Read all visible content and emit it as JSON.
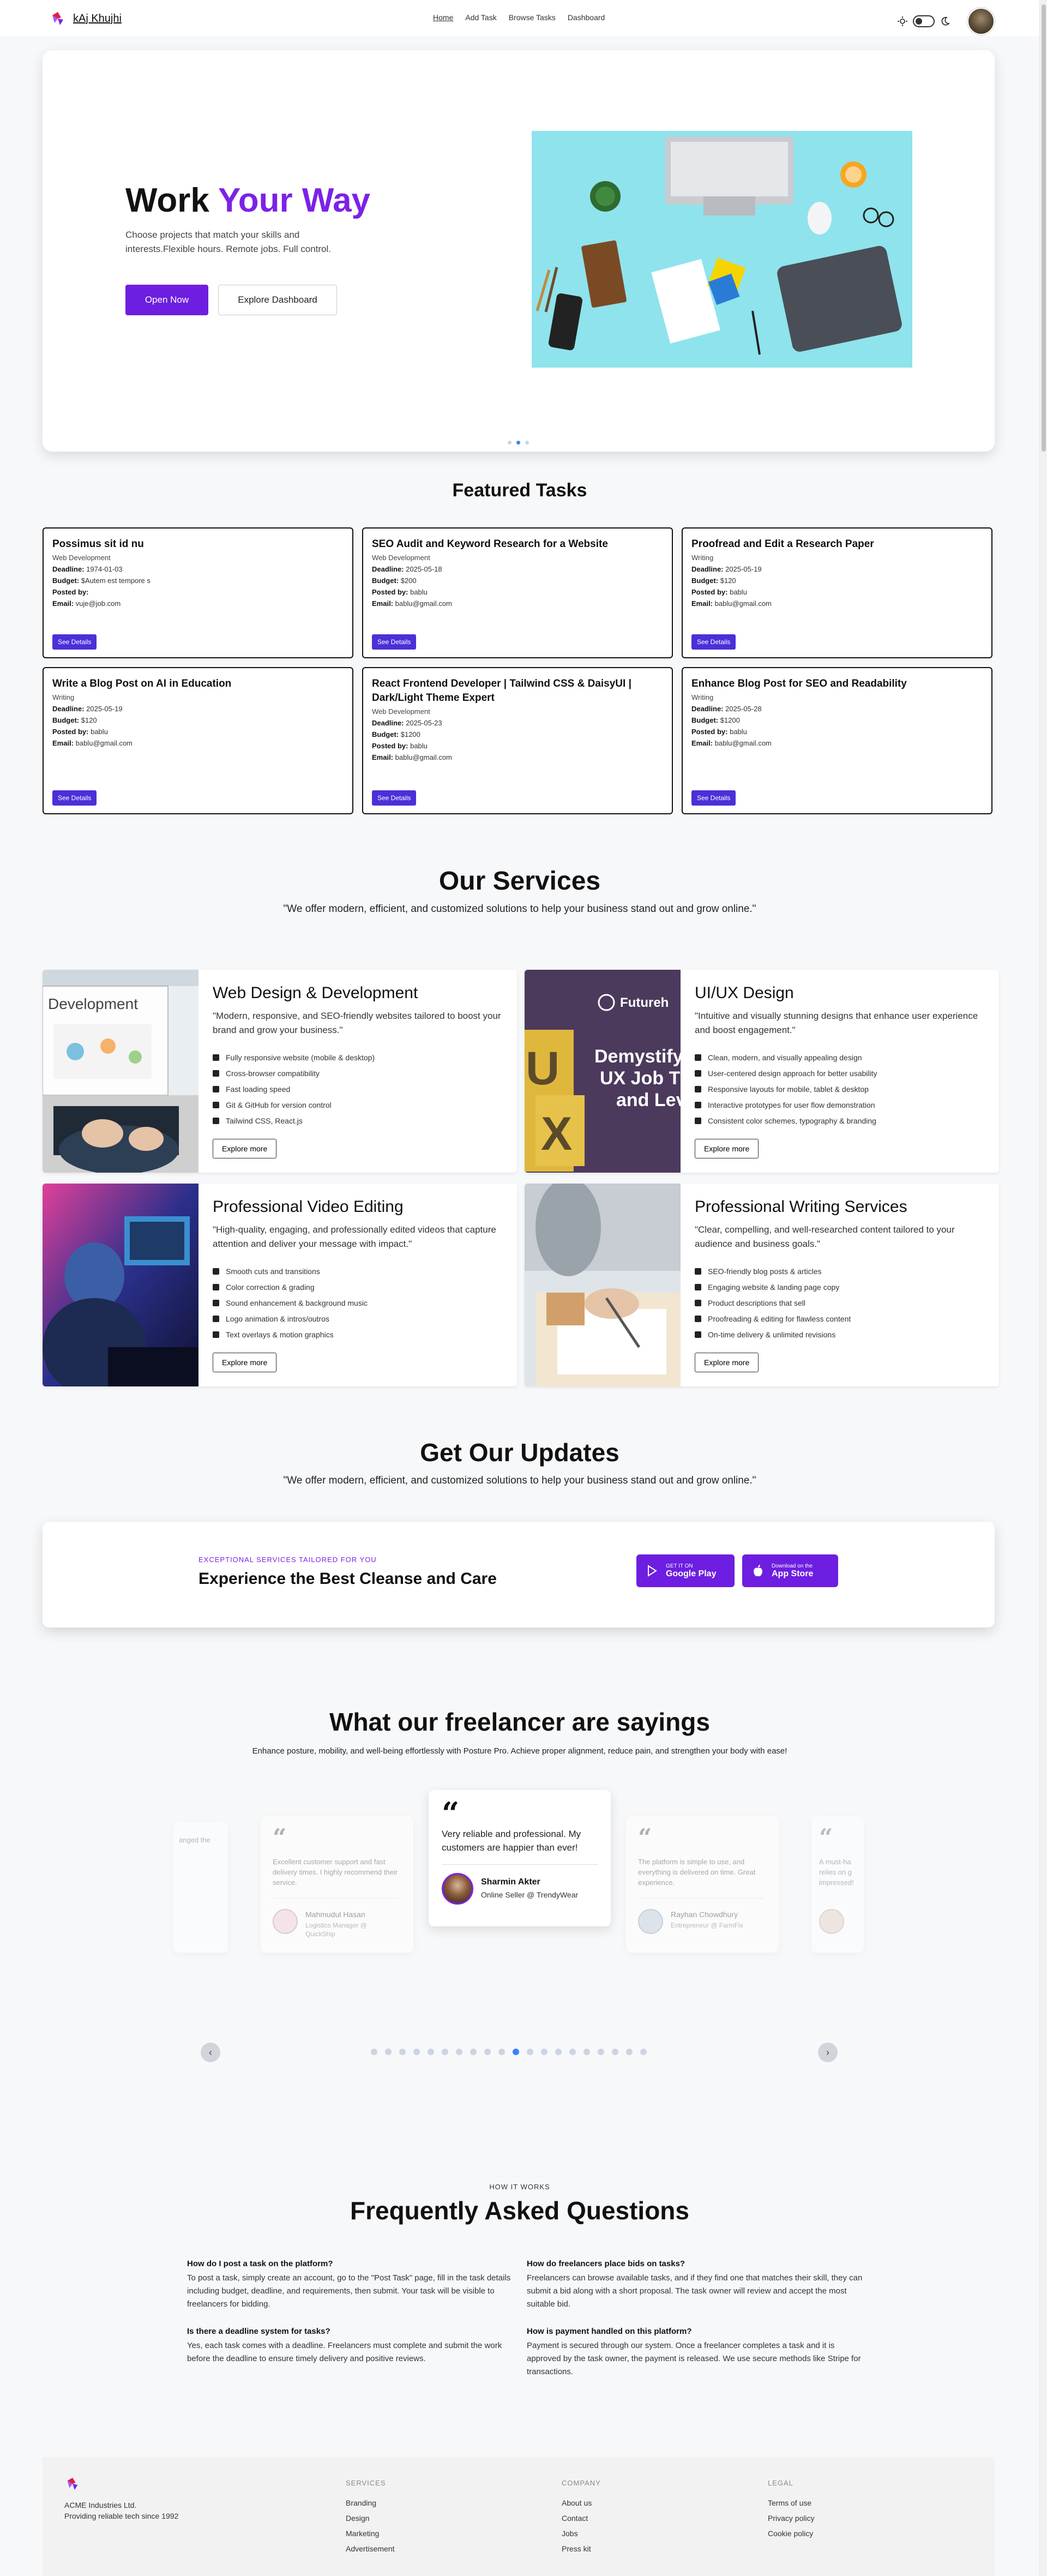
{
  "nav": {
    "brand": "kAj Khujhi",
    "links": [
      "Home",
      "Add Task",
      "Browse Tasks",
      "Dashboard"
    ]
  },
  "hero": {
    "title_part1": "Work",
    "title_part2": "Your Way",
    "subtitle": "Choose projects that match your skills and interests.Flexible hours. Remote jobs. Full control.",
    "primary_button": "Open Now",
    "secondary_button": "Explore Dashboard"
  },
  "featured": {
    "title": "Featured Tasks",
    "button_label": "See Details",
    "labels": {
      "deadline": "Deadline:",
      "budget": "Budget:",
      "posted_by": "Posted by:",
      "email": "Email:"
    },
    "tasks": [
      {
        "title": "Possimus sit id nu",
        "category": "Web Development",
        "deadline": "1974-01-03",
        "budget": "$Autem est tempore s",
        "posted_by": "",
        "email": "vuje@job.com"
      },
      {
        "title": "SEO Audit and Keyword Research for a Website",
        "category": "Web Development",
        "deadline": "2025-05-18",
        "budget": "$200",
        "posted_by": "bablu",
        "email": "bablu@gmail.com"
      },
      {
        "title": "Proofread and Edit a Research Paper",
        "category": "Writing",
        "deadline": "2025-05-19",
        "budget": "$120",
        "posted_by": "bablu",
        "email": "bablu@gmail.com"
      },
      {
        "title": "Write a Blog Post on AI in Education",
        "category": "Writing",
        "deadline": "2025-05-19",
        "budget": "$120",
        "posted_by": "bablu",
        "email": "bablu@gmail.com"
      },
      {
        "title": "React Frontend Developer | Tailwind CSS & DaisyUI | Dark/Light Theme Expert",
        "category": "Web Development",
        "deadline": "2025-05-23",
        "budget": "$1200",
        "posted_by": "bablu",
        "email": "bablu@gmail.com"
      },
      {
        "title": "Enhance Blog Post for SEO and Readability",
        "category": "Writing",
        "deadline": "2025-05-28",
        "budget": "$1200",
        "posted_by": "bablu",
        "email": "bablu@gmail.com"
      }
    ]
  },
  "services": {
    "title": "Our Services",
    "subtitle": "\"We offer modern, efficient, and customized solutions to help your business stand out and grow online.\"",
    "explore_label": "Explore more",
    "items": [
      {
        "title": "Web Design & Development",
        "desc": "\"Modern, responsive, and SEO-friendly websites tailored to boost your brand and grow your business.\"",
        "image_text": "Development",
        "features": [
          "Fully responsive website (mobile & desktop)",
          "Cross-browser compatibility",
          "Fast loading speed",
          "Git & GitHub for version control",
          "Tailwind CSS, React.js"
        ]
      },
      {
        "title": "UI/UX Design",
        "desc": "\"Intuitive and visually stunning designs that enhance user experience and boost engagement.\"",
        "image_text_brand": "Futureh",
        "image_text_lines": [
          "Demystify",
          "UX Job T",
          "and Lev"
        ],
        "features": [
          "Clean, modern, and visually appealing design",
          "User-centered design approach for better usability",
          "Responsive layouts for mobile, tablet & desktop",
          "Interactive prototypes for user flow demonstration",
          "Consistent color schemes, typography & branding"
        ]
      },
      {
        "title": "Professional Video Editing",
        "desc": "\"High-quality, engaging, and professionally edited videos that capture attention and deliver your message with impact.\"",
        "features": [
          "Smooth cuts and transitions",
          "Color correction & grading",
          "Sound enhancement & background music",
          "Logo animation & intros/outros",
          "Text overlays & motion graphics"
        ]
      },
      {
        "title": "Professional Writing Services",
        "desc": "\"Clear, compelling, and well-researched content tailored to your audience and business goals.\"",
        "features": [
          "SEO-friendly blog posts & articles",
          "Engaging website & landing page copy",
          "Product descriptions that sell",
          "Proofreading & editing for flawless content",
          "On-time delivery & unlimited revisions"
        ]
      }
    ]
  },
  "updates": {
    "title": "Get Our Updates",
    "subtitle": "\"We offer modern, efficient, and customized solutions to help your business stand out and grow online.\"",
    "tag": "EXCEPTIONAL SERVICES TAILORED FOR YOU",
    "heading": "Experience the Best Cleanse and Care",
    "google_small": "GET IT ON",
    "google_big": "Google Play",
    "apple_small": "Download on the",
    "apple_big": "App Store"
  },
  "testimonials": {
    "title": "What our freelancer are sayings",
    "subtitle": "Enhance posture, mobility, and well-being effortlessly with Posture Pro. Achieve proper alignment, reduce pain, and strengthen your body with ease!",
    "edge_left_text": "anged the",
    "edge_right_text": "A must-ha\nrelies on g\nimpressed!",
    "center": {
      "quote": "Very reliable and professional. My customers are happier than ever!",
      "name": "Sharmin Akter",
      "role": "Online Seller @ TrendyWear"
    },
    "left": {
      "quote": "Excellent customer support and fast delivery times. I highly recommend their service.",
      "name": "Mahmudul Hasan",
      "role": "Logistics Manager @ QuickShip"
    },
    "right": {
      "quote": "The platform is simple to use, and everything is delivered on time. Great experience.",
      "name": "Rayhan Chowdhury",
      "role": "Entrepreneur @ FarmFix"
    },
    "active_dot": 10,
    "dot_count": 20
  },
  "faq": {
    "eyebrow": "HOW IT WORKS",
    "title": "Frequently Asked Questions",
    "items": [
      {
        "q": "How do I post a task on the platform?",
        "a": "To post a task, simply create an account, go to the \"Post Task\" page, fill in the task details including budget, deadline, and requirements, then submit. Your task will be visible to freelancers for bidding."
      },
      {
        "q": "How do freelancers place bids on tasks?",
        "a": "Freelancers can browse available tasks, and if they find one that matches their skill, they can submit a bid along with a short proposal. The task owner will review and accept the most suitable bid."
      },
      {
        "q": "Is there a deadline system for tasks?",
        "a": "Yes, each task comes with a deadline. Freelancers must complete and submit the work before the deadline to ensure timely delivery and positive reviews."
      },
      {
        "q": "How is payment handled on this platform?",
        "a": "Payment is secured through our system. Once a freelancer completes a task and it is approved by the task owner, the payment is released. We use secure methods like Stripe for transactions."
      }
    ]
  },
  "footer": {
    "company": "ACME Industries Ltd.",
    "tagline": "Providing reliable tech since 1992",
    "services_h": "SERVICES",
    "services": [
      "Branding",
      "Design",
      "Marketing",
      "Advertisement"
    ],
    "company_h": "COMPANY",
    "company_links": [
      "About us",
      "Contact",
      "Jobs",
      "Press kit"
    ],
    "legal_h": "LEGAL",
    "legal": [
      "Terms of use",
      "Privacy policy",
      "Cookie policy"
    ]
  },
  "colors": {
    "accent": "#7c22e6",
    "primary_button": "#6d1ee0",
    "task_button": "#4c2fd8",
    "dot_active": "#3b82f6"
  }
}
